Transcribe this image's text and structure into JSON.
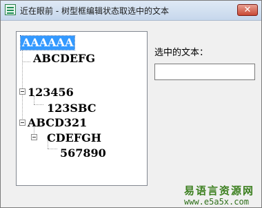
{
  "window": {
    "title": "近在眼前 - 树型框编辑状态取选中的文本",
    "icon": "app-logo-icon",
    "close_glyph": "✕"
  },
  "tree": {
    "nodes": [
      {
        "label": "AAAAAA",
        "level": 0,
        "selected": true
      },
      {
        "label": "ABCDEFG",
        "level": 1,
        "selected": false
      },
      {
        "label": "123456",
        "level": 1,
        "selected": false,
        "expanded": true
      },
      {
        "label": "123SBC",
        "level": 2,
        "selected": false
      },
      {
        "label": "ABCD321",
        "level": 1,
        "selected": false,
        "expanded": true
      },
      {
        "label": "CDEFGH",
        "level": 2,
        "selected": false,
        "expanded": true
      },
      {
        "label": "567890",
        "level": 3,
        "selected": false
      }
    ]
  },
  "selected_text": {
    "label": "选中的文本：",
    "value": ""
  },
  "watermark": {
    "site_name": "易语言资源网",
    "url": "www.e5a5x.com"
  },
  "colors": {
    "selection": "#3399ff",
    "watermark": "#3b7f1e"
  }
}
